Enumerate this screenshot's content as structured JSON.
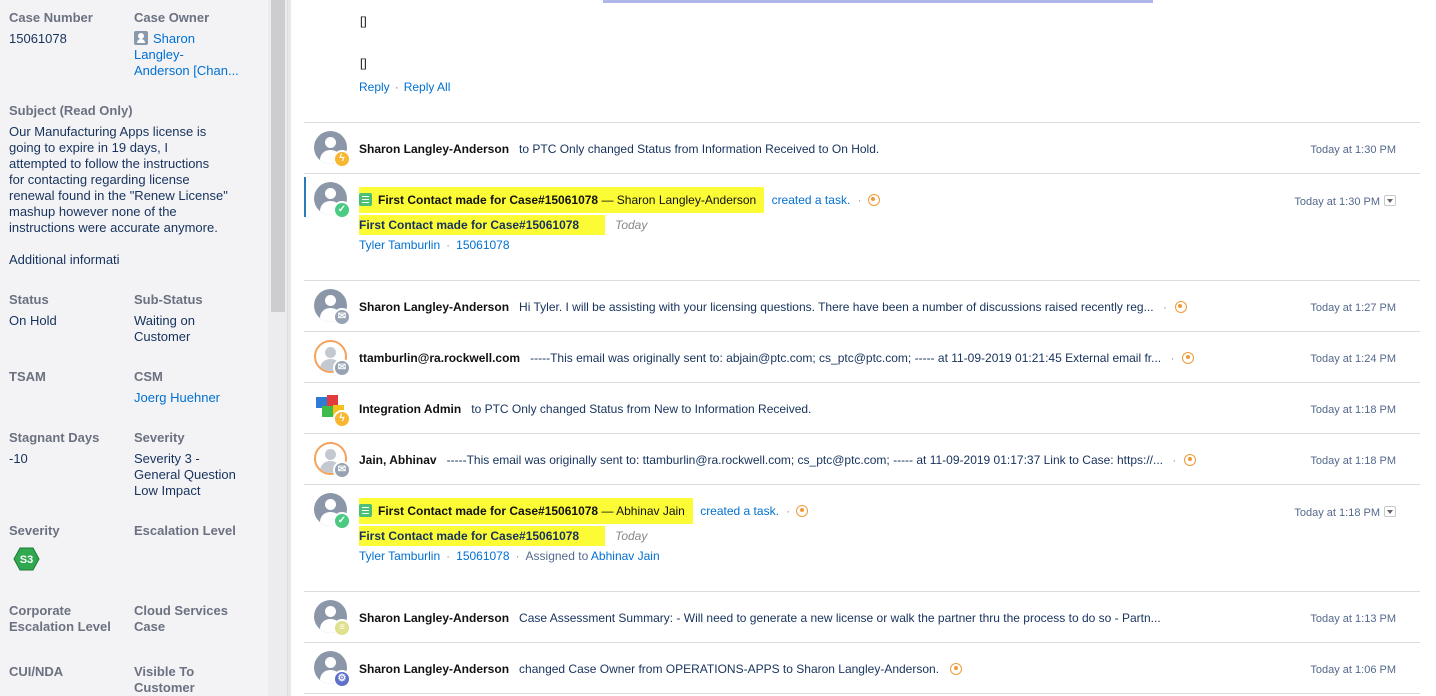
{
  "left_panel": {
    "case_number": {
      "label": "Case Number",
      "value": "15061078"
    },
    "case_owner": {
      "label": "Case Owner",
      "lines": [
        "Sharon",
        "Langley-",
        "Anderson [Chan..."
      ]
    },
    "subject": {
      "label": "Subject (Read Only)",
      "lines": [
        "Our Manufacturing Apps license is",
        "going to expire in 19 days, I",
        "attempted to follow the instructions",
        "for contacting regarding license",
        "renewal found in the \"Renew License\"",
        "mashup however none of the",
        "instructions were accurate anymore."
      ]
    },
    "additional_info": "Additional informati",
    "status": {
      "label": "Status",
      "value": "On Hold"
    },
    "sub_status": {
      "label": "Sub-Status",
      "lines": [
        "Waiting on",
        "Customer"
      ]
    },
    "tsam": {
      "label": "TSAM",
      "value": ""
    },
    "csm": {
      "label": "CSM",
      "value": "Joerg Huehner"
    },
    "stagnant_days": {
      "label": "Stagnant Days",
      "value": "-10"
    },
    "severity_text": {
      "label": "Severity",
      "lines": [
        "Severity 3 -",
        "General Question",
        "Low Impact"
      ]
    },
    "severity_badge": {
      "label": "Severity",
      "value": "S3",
      "color": "#2fa84f"
    },
    "escalation_level": {
      "label": "Escalation Level"
    },
    "corporate_escalation": {
      "lines": [
        "Corporate",
        "Escalation Level"
      ]
    },
    "cloud_services": {
      "lines": [
        "Cloud Services",
        "Case"
      ]
    },
    "cui_nda": {
      "label": "CUI/NDA"
    },
    "visible_to_customer": {
      "lines": [
        "Visible To",
        "Customer"
      ]
    }
  },
  "email_top": {
    "bracket": "[]",
    "reply": "Reply",
    "reply_all": "Reply All"
  },
  "feed": [
    {
      "author": "Sharon Langley-Anderson",
      "text": "to PTC Only changed Status from Information Received to On Hold.",
      "time": "Today at 1:30 PM",
      "badge": "bolt-icon"
    },
    {
      "task_title": "First Contact made for Case#15061078",
      "task_who": "— Sharon Langley-Anderson",
      "action": "created a task.",
      "sub_title": "First Contact made for Case#15061078",
      "today": "Today",
      "link1": "Tyler Tamburlin",
      "link2": "15061078",
      "time": "Today at 1:30 PM",
      "badge": "check-icon"
    },
    {
      "author": "Sharon Langley-Anderson",
      "text": "Hi Tyler. I will be assisting with your licensing questions. There have been a number of discussions raised recently reg...",
      "time": "Today at 1:27 PM",
      "badge": "mail-icon"
    },
    {
      "author": "ttamburlin@ra.rockwell.com",
      "text": "-----This email was originally sent to: abjain@ptc.com; cs_ptc@ptc.com; ----- at 11-09-2019 01:21:45 External email fr...",
      "time": "Today at 1:24 PM",
      "badge": "mail-icon"
    },
    {
      "author": "Integration Admin",
      "text": "to PTC Only changed Status from New to Information Received.",
      "time": "Today at 1:18 PM",
      "badge": "bolt-icon"
    },
    {
      "author": "Jain, Abhinav",
      "text": "-----This email was originally sent to: ttamburlin@ra.rockwell.com; cs_ptc@ptc.com; ----- at 11-09-2019 01:17:37 Link to Case: https://...",
      "time": "Today at 1:18 PM",
      "badge": "mail-icon"
    },
    {
      "task_title": "First Contact made for Case#15061078",
      "task_who": "— Abhinav Jain",
      "action": "created a task.",
      "sub_title": "First Contact made for Case#15061078",
      "today": "Today",
      "link1": "Tyler Tamburlin",
      "link2": "15061078",
      "assigned_label": "Assigned to",
      "assigned_to": "Abhinav Jain",
      "time": "Today at 1:18 PM",
      "badge": "check-icon"
    },
    {
      "author": "Sharon Langley-Anderson",
      "text": "Case Assessment Summary: - Will need to generate a new license or walk the partner thru the process to do so - Partn...",
      "time": "Today at 1:13 PM",
      "badge": "list-icon"
    },
    {
      "author": "Sharon Langley-Anderson",
      "text": "changed Case Owner from OPERATIONS-APPS to Sharon Langley-Anderson.",
      "time": "Today at 1:06 PM",
      "badge": "gear-icon"
    }
  ],
  "colors": {
    "highlight": "#fbfb36",
    "link": "#0070d2",
    "panel_bg": "#f3f3f5"
  }
}
